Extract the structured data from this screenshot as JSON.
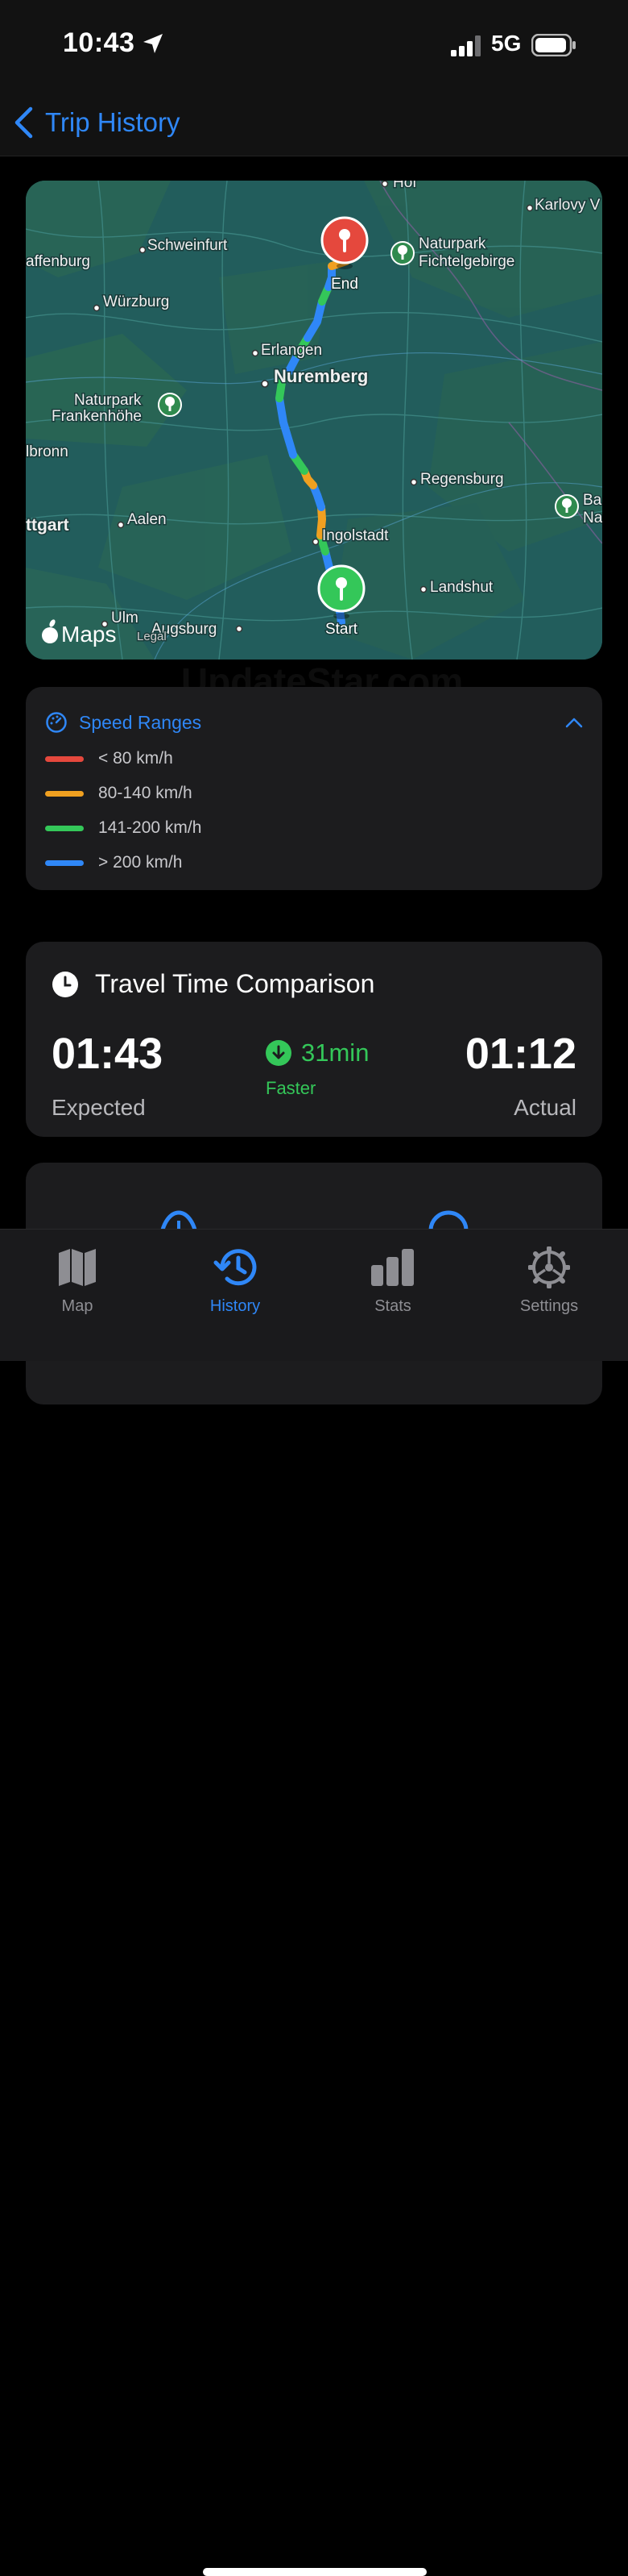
{
  "status": {
    "time": "10:43",
    "network": "5G"
  },
  "nav": {
    "back_label": "Trip History"
  },
  "map": {
    "labels": {
      "hof": "Hof",
      "karlovy": "Karlovy V",
      "schweinfurt": "Schweinfurt",
      "aschaffenburg": "affenburg",
      "naturpark_fichtel_1": "Naturpark",
      "naturpark_fichtel_2": "Fichtelgebirge",
      "wurzburg": "Würzburg",
      "erlangen": "Erlangen",
      "nuremberg": "Nuremberg",
      "naturpark_franken_1": "Naturpark",
      "naturpark_franken_2": "Frankenhöhe",
      "heilbronn": "lbronn",
      "regensburg": "Regensburg",
      "stuttgart": "ttgart",
      "aalen": "Aalen",
      "ingolstadt": "Ingolstadt",
      "landshut": "Landshut",
      "ulm": "Ulm",
      "augsburg": "Augsburg",
      "bay_1": "Ba",
      "bay_2": "Na",
      "legal": "Legal"
    },
    "start_label": "Start",
    "end_label": "End",
    "brand": "Maps"
  },
  "watermark": "UpdateStar.com",
  "speed_ranges": {
    "title": "Speed Ranges",
    "items": [
      {
        "label": "< 80 km/h",
        "color": "#e5483d"
      },
      {
        "label": "80-140 km/h",
        "color": "#f0a020"
      },
      {
        "label": "141-200 km/h",
        "color": "#34c759"
      },
      {
        "label": "> 200 km/h",
        "color": "#2f87f7"
      }
    ]
  },
  "travel_time": {
    "title": "Travel Time Comparison",
    "expected_value": "01:43",
    "expected_label": "Expected",
    "actual_value": "01:12",
    "actual_label": "Actual",
    "diff_value": "31min",
    "diff_label": "Faster"
  },
  "tabs": [
    {
      "label": "Map"
    },
    {
      "label": "History"
    },
    {
      "label": "Stats"
    },
    {
      "label": "Settings"
    }
  ]
}
